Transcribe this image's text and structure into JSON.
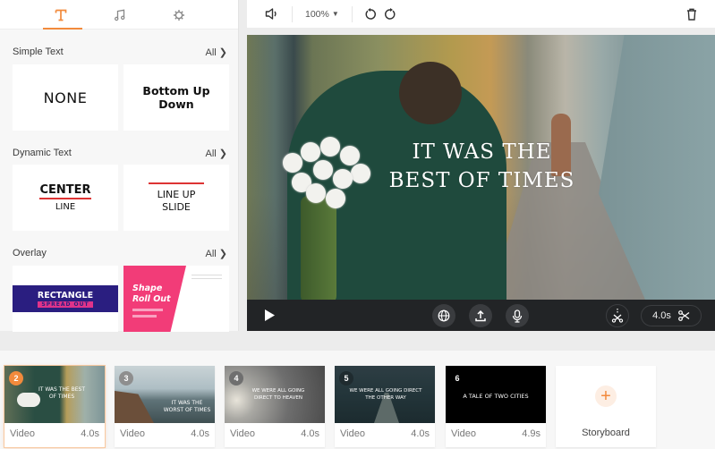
{
  "left_panel": {
    "tabs": [
      {
        "name": "text",
        "icon": "text-icon",
        "active": true
      },
      {
        "name": "music",
        "icon": "music-note-icon",
        "active": false
      },
      {
        "name": "settings",
        "icon": "gear-icon",
        "active": false
      }
    ],
    "sections": [
      {
        "title": "Simple Text",
        "all_label": "All",
        "items": [
          {
            "label": "NONE"
          },
          {
            "label_line1": "Bottom Up",
            "label_line2": "Down"
          }
        ]
      },
      {
        "title": "Dynamic Text",
        "all_label": "All",
        "items": [
          {
            "label_line1": "CENTER",
            "label_line2": "LINE"
          },
          {
            "label_line1": "LINE UP",
            "label_line2": "SLIDE"
          }
        ]
      },
      {
        "title": "Overlay",
        "all_label": "All",
        "items": [
          {
            "label_line1": "RECTANGLE",
            "label_line2": "SPREAD OUT"
          },
          {
            "label_line1": "Shape",
            "label_line2": "Roll Out"
          }
        ]
      }
    ]
  },
  "toolbar": {
    "zoom_level": "100%",
    "icons": [
      "speaker-icon",
      "undo-icon",
      "redo-icon",
      "trash-icon"
    ]
  },
  "preview": {
    "caption_line1": "IT WAS THE",
    "caption_line2": "BEST OF TIMES",
    "duration": "4.0s"
  },
  "timeline": {
    "clips": [
      {
        "number": "2",
        "type": "Video",
        "duration": "4.0s",
        "caption": "IT WAS THE BEST OF TIMES",
        "selected": true
      },
      {
        "number": "3",
        "type": "Video",
        "duration": "4.0s",
        "caption": "IT WAS THE WORST OF TIMES",
        "selected": false
      },
      {
        "number": "4",
        "type": "Video",
        "duration": "4.0s",
        "caption": "WE WERE ALL GOING DIRECT TO HEAVEN",
        "selected": false
      },
      {
        "number": "5",
        "type": "Video",
        "duration": "4.0s",
        "caption": "WE WERE ALL GOING DIRECT THE OTHER WAY",
        "selected": false
      },
      {
        "number": "6",
        "type": "Video",
        "duration": "4.9s",
        "caption": "A TALE OF TWO CITIES",
        "selected": false
      }
    ],
    "storyboard_label": "Storyboard"
  },
  "colors": {
    "accent": "#f28a3c",
    "overlay_navy": "#2a1e80",
    "overlay_pink": "#f23c78",
    "control_bar": "#222426"
  }
}
